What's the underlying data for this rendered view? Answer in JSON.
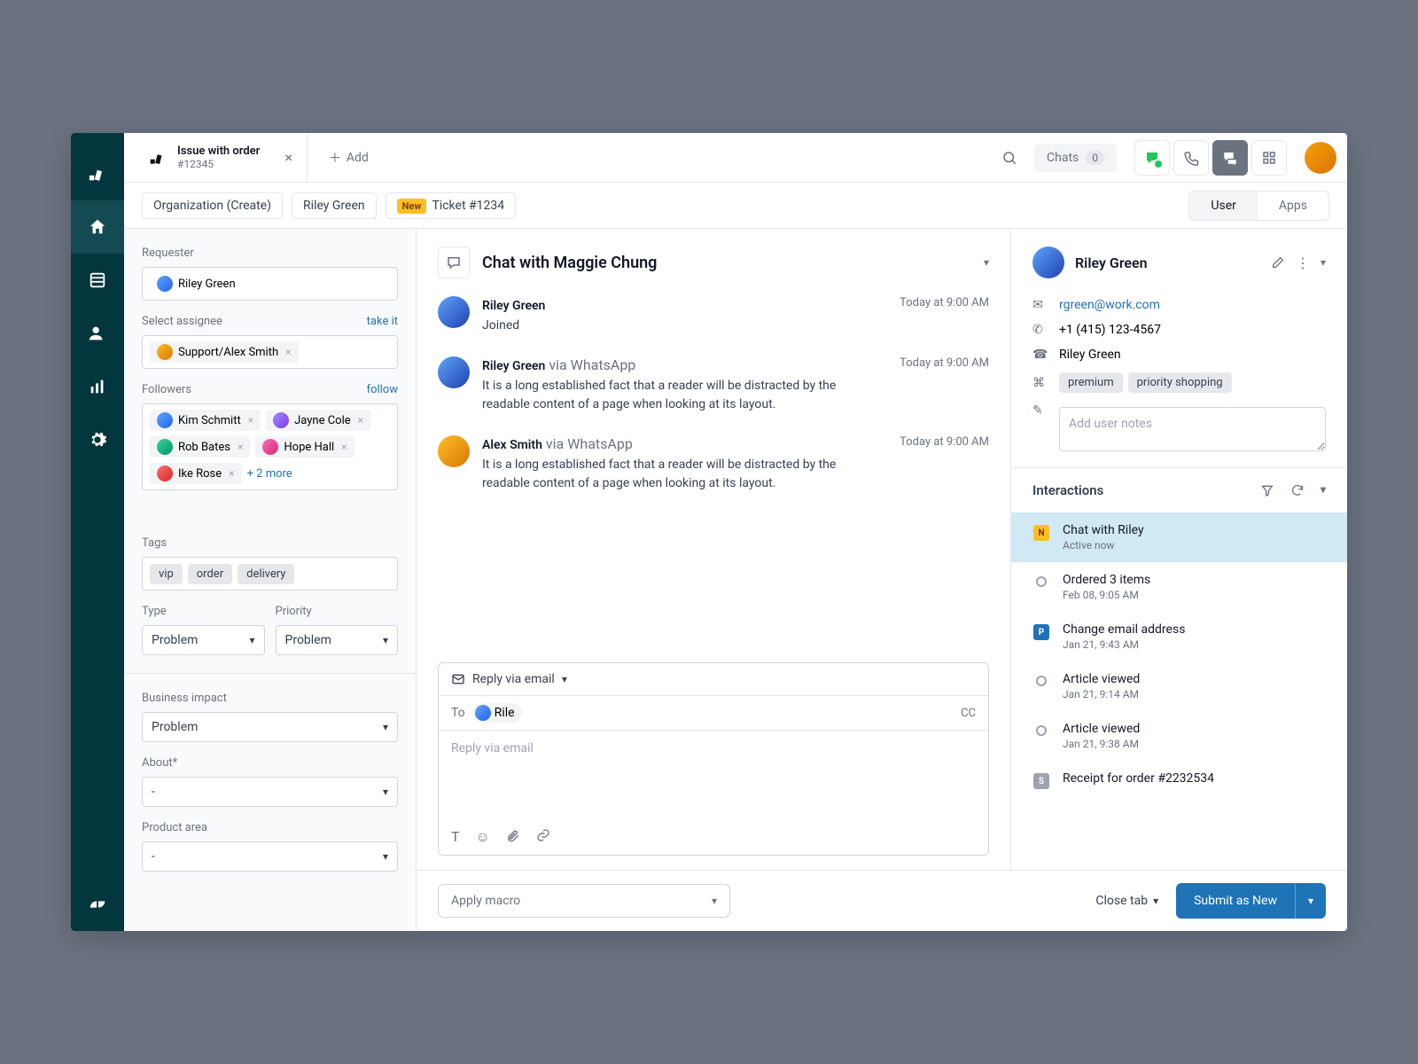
{
  "topbar": {
    "tab_title": "Issue with order",
    "tab_sub": "#12345",
    "add_label": "Add",
    "chats_label": "Chats",
    "chats_count": "0"
  },
  "subheader": {
    "org": "Organization (Create)",
    "requester": "Riley Green",
    "new_badge": "New",
    "ticket": "Ticket #1234",
    "toggle_user": "User",
    "toggle_apps": "Apps"
  },
  "left": {
    "requester_label": "Requester",
    "requester_value": "Riley Green",
    "assignee_label": "Select assignee",
    "assignee_action": "take it",
    "assignee_value": "Support/Alex Smith",
    "followers_label": "Followers",
    "followers_action": "follow",
    "followers": [
      "Kim Schmitt",
      "Jayne Cole",
      "Rob Bates",
      "Hope Hall",
      "Ike Rose"
    ],
    "followers_more": "+ 2 more",
    "tags_label": "Tags",
    "tags": [
      "vip",
      "order",
      "delivery"
    ],
    "type_label": "Type",
    "type_value": "Problem",
    "priority_label": "Priority",
    "priority_value": "Problem",
    "business_label": "Business impact",
    "business_value": "Problem",
    "about_label": "About*",
    "about_value": "-",
    "product_label": "Product area",
    "product_value": "-"
  },
  "convo": {
    "title": "Chat with Maggie Chung",
    "messages": [
      {
        "name": "Riley Green",
        "via": "",
        "time": "Today at 9:00 AM",
        "text": "Joined"
      },
      {
        "name": "Riley Green",
        "via": " via WhatsApp",
        "time": "Today at 9:00 AM",
        "text": "It is a long established fact that a reader will be distracted by the readable content of a page when looking at its layout."
      },
      {
        "name": "Alex Smith",
        "via": " via WhatsApp",
        "time": "Today at 9:00 AM",
        "text": "It is a long established fact that a reader will be distracted by the readable content of a page when looking at its layout."
      }
    ],
    "reply_mode": "Reply via email",
    "to_label": "To",
    "to_chip": "Rile",
    "cc": "CC",
    "placeholder": "Reply via email"
  },
  "bottom": {
    "macro": "Apply macro",
    "close_tab": "Close tab",
    "submit": "Submit as New"
  },
  "right": {
    "name": "Riley Green",
    "email": "rgreen@work.com",
    "phone": "+1 (415) 123-4567",
    "display": "Riley Green",
    "tags": [
      "premium",
      "priority shopping"
    ],
    "notes_placeholder": "Add user notes",
    "interactions_title": "Interactions",
    "timeline": [
      {
        "badge": "y",
        "badge_text": "N",
        "title": "Chat with Riley",
        "sub": "Active now",
        "active": true
      },
      {
        "badge": "dot",
        "title": "Ordered 3 items",
        "sub": "Feb 08, 9:05 AM"
      },
      {
        "badge": "b",
        "badge_text": "P",
        "title": "Change email address",
        "sub": "Jan 21, 9:43 AM"
      },
      {
        "badge": "dot",
        "title": "Article viewed",
        "sub": "Jan 21, 9:14 AM"
      },
      {
        "badge": "dot",
        "title": "Article viewed",
        "sub": "Jan 21, 9:38 AM"
      },
      {
        "badge": "g",
        "badge_text": "S",
        "title": "Receipt for order #2232534",
        "sub": ""
      }
    ]
  }
}
